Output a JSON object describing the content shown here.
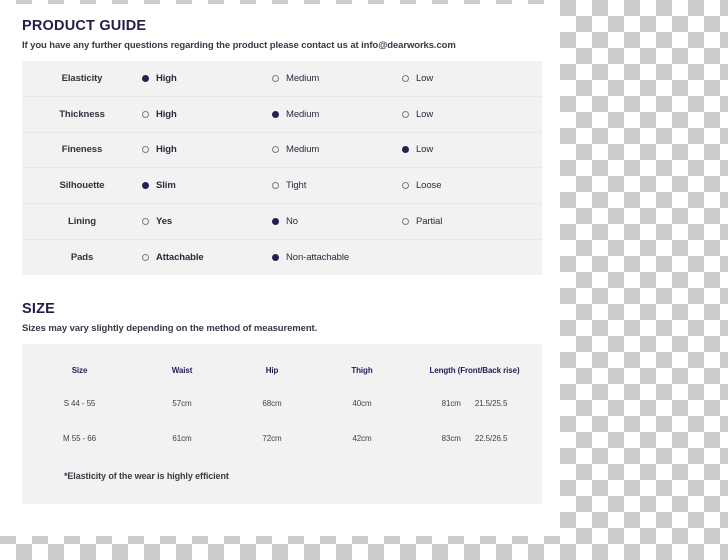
{
  "colors": {
    "heading": "#222049",
    "panel_bg": "#f2f2f3",
    "radio_on": "#232154",
    "radio_off": "#7b7a88",
    "canvas": "#ffffff",
    "checker": "#cccccc"
  },
  "product_guide": {
    "title": "PRODUCT GUIDE",
    "subtitle": "If you have any further questions regarding the product please contact us at info@dearworks.com",
    "rows": [
      {
        "label": "Elasticity",
        "options": [
          {
            "label": "High",
            "selected": true
          },
          {
            "label": "Medium",
            "selected": false
          },
          {
            "label": "Low",
            "selected": false
          }
        ]
      },
      {
        "label": "Thickness",
        "options": [
          {
            "label": "High",
            "selected": false
          },
          {
            "label": "Medium",
            "selected": true
          },
          {
            "label": "Low",
            "selected": false
          }
        ]
      },
      {
        "label": "Fineness",
        "options": [
          {
            "label": "High",
            "selected": false
          },
          {
            "label": "Medium",
            "selected": false
          },
          {
            "label": "Low",
            "selected": true
          }
        ]
      },
      {
        "label": "Silhouette",
        "options": [
          {
            "label": "Slim",
            "selected": true
          },
          {
            "label": "Tight",
            "selected": false
          },
          {
            "label": "Loose",
            "selected": false
          }
        ]
      },
      {
        "label": "Lining",
        "options": [
          {
            "label": "Yes",
            "selected": false
          },
          {
            "label": "No",
            "selected": true
          },
          {
            "label": "Partial",
            "selected": false
          }
        ]
      },
      {
        "label": "Pads",
        "options": [
          {
            "label": "Attachable",
            "selected": false
          },
          {
            "label": "Non-attachable",
            "selected": true
          }
        ]
      }
    ]
  },
  "size": {
    "title": "SIZE",
    "subtitle": "Sizes may vary slightly depending on the method of measurement.",
    "headers": {
      "size": "Size",
      "waist": "Waist",
      "hip": "Hip",
      "thigh": "Thigh",
      "length": "Length (Front/Back rise)"
    },
    "rows": [
      {
        "size": "S  44  -  55",
        "waist": "57cm",
        "hip": "68cm",
        "thigh": "40cm",
        "length_total": "81cm",
        "length_rise": "21.5/25.5"
      },
      {
        "size": "M  55  -  66",
        "waist": "61cm",
        "hip": "72cm",
        "thigh": "42cm",
        "length_total": "83cm",
        "length_rise": "22.5/26.5"
      }
    ],
    "note": "*Elasticity of the wear is highly efficient"
  }
}
